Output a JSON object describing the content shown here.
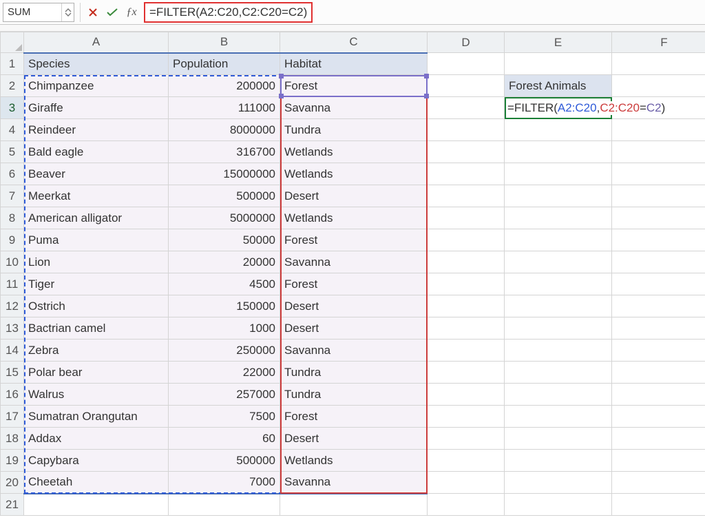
{
  "formula_bar": {
    "name_box": "SUM",
    "formula_text": "=FILTER(A2:C20,C2:C20=C2)"
  },
  "columns": [
    "A",
    "B",
    "C",
    "D",
    "E",
    "F"
  ],
  "row_count": 21,
  "headers": {
    "A": "Species",
    "B": "Population",
    "C": "Habitat"
  },
  "e2_label": "Forest Animals",
  "editing_cell": {
    "ref": "E3",
    "prefix": "=FILTER(",
    "range1": "A2:C20",
    "sep1": ",",
    "range2": "C2:C20",
    "sep2": "=",
    "range3": "C2",
    "suffix": ")"
  },
  "chart_data": {
    "type": "table",
    "columns": [
      "Species",
      "Population",
      "Habitat"
    ],
    "rows": [
      {
        "Species": "Chimpanzee",
        "Population": 200000,
        "Habitat": "Forest"
      },
      {
        "Species": "Giraffe",
        "Population": 111000,
        "Habitat": "Savanna"
      },
      {
        "Species": "Reindeer",
        "Population": 8000000,
        "Habitat": "Tundra"
      },
      {
        "Species": "Bald eagle",
        "Population": 316700,
        "Habitat": "Wetlands"
      },
      {
        "Species": "Beaver",
        "Population": 15000000,
        "Habitat": "Wetlands"
      },
      {
        "Species": "Meerkat",
        "Population": 500000,
        "Habitat": "Desert"
      },
      {
        "Species": "American alligator",
        "Population": 5000000,
        "Habitat": "Wetlands"
      },
      {
        "Species": "Puma",
        "Population": 50000,
        "Habitat": "Forest"
      },
      {
        "Species": "Lion",
        "Population": 20000,
        "Habitat": "Savanna"
      },
      {
        "Species": "Tiger",
        "Population": 4500,
        "Habitat": "Forest"
      },
      {
        "Species": "Ostrich",
        "Population": 150000,
        "Habitat": "Desert"
      },
      {
        "Species": "Bactrian camel",
        "Population": 1000,
        "Habitat": "Desert"
      },
      {
        "Species": "Zebra",
        "Population": 250000,
        "Habitat": "Savanna"
      },
      {
        "Species": "Polar bear",
        "Population": 22000,
        "Habitat": "Tundra"
      },
      {
        "Species": "Walrus",
        "Population": 257000,
        "Habitat": "Tundra"
      },
      {
        "Species": "Sumatran Orangutan",
        "Population": 7500,
        "Habitat": "Forest"
      },
      {
        "Species": "Addax",
        "Population": 60,
        "Habitat": "Desert"
      },
      {
        "Species": "Capybara",
        "Population": 500000,
        "Habitat": "Wetlands"
      },
      {
        "Species": "Cheetah",
        "Population": 7000,
        "Habitat": "Savanna"
      }
    ]
  }
}
